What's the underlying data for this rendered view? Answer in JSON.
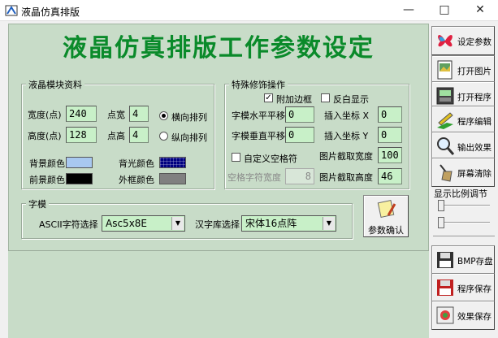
{
  "window": {
    "title": "液晶仿真排版"
  },
  "main_title": "液晶仿真排版工作参数设定",
  "lcd_group": {
    "label": "液晶模块资料",
    "width_label": "宽度(点)",
    "width_value": "240",
    "height_label": "高度(点)",
    "height_value": "128",
    "dotw_label": "点宽",
    "dotw_value": "4",
    "doth_label": "点高",
    "doth_value": "4",
    "radio_h": "横向排列",
    "radio_v": "纵向排列",
    "bg_label": "背景颜色",
    "backlight_label": "背光颜色",
    "fg_label": "前景颜色",
    "frame_label": "外框颜色"
  },
  "deco_group": {
    "label": "特殊修饰操作",
    "add_border": "附加边框",
    "invert": "反白显示",
    "hspace_label": "字模水平平移",
    "hspace_value": "0",
    "vspace_label": "字模垂直平移",
    "vspace_value": "0",
    "insx_label": "插入坐标 X",
    "insx_value": "0",
    "insy_label": "插入坐标 Y",
    "insy_value": "0",
    "custom_space": "自定义空格符",
    "space_width_label": "空格字符宽度",
    "space_width_value": "8",
    "capw_label": "图片截取宽度",
    "capw_value": "100",
    "caph_label": "图片截取高度",
    "caph_value": "46"
  },
  "font_group": {
    "label": "字模",
    "ascii_label": "ASCII字符选择",
    "ascii_value": "Asc5x8E",
    "hz_label": "汉字库选择",
    "hz_value": "宋体16点阵",
    "confirm": "参数确认"
  },
  "sidebar": {
    "set_params": "设定参数",
    "open_image": "打开图片",
    "open_program": "打开程序",
    "edit_program": "程序编辑",
    "output_effect": "输出效果",
    "clear_screen": "屏幕清除",
    "scale_label": "显示比例调节",
    "bmp_save": "BMP存盘",
    "program_save": "程序保存",
    "effect_save": "效果保存"
  },
  "colors": {
    "bg": "#a8c8f0",
    "backlight": "#000080",
    "fg": "#000000",
    "frame": "#808080",
    "title_green": "#0a8a2a"
  }
}
